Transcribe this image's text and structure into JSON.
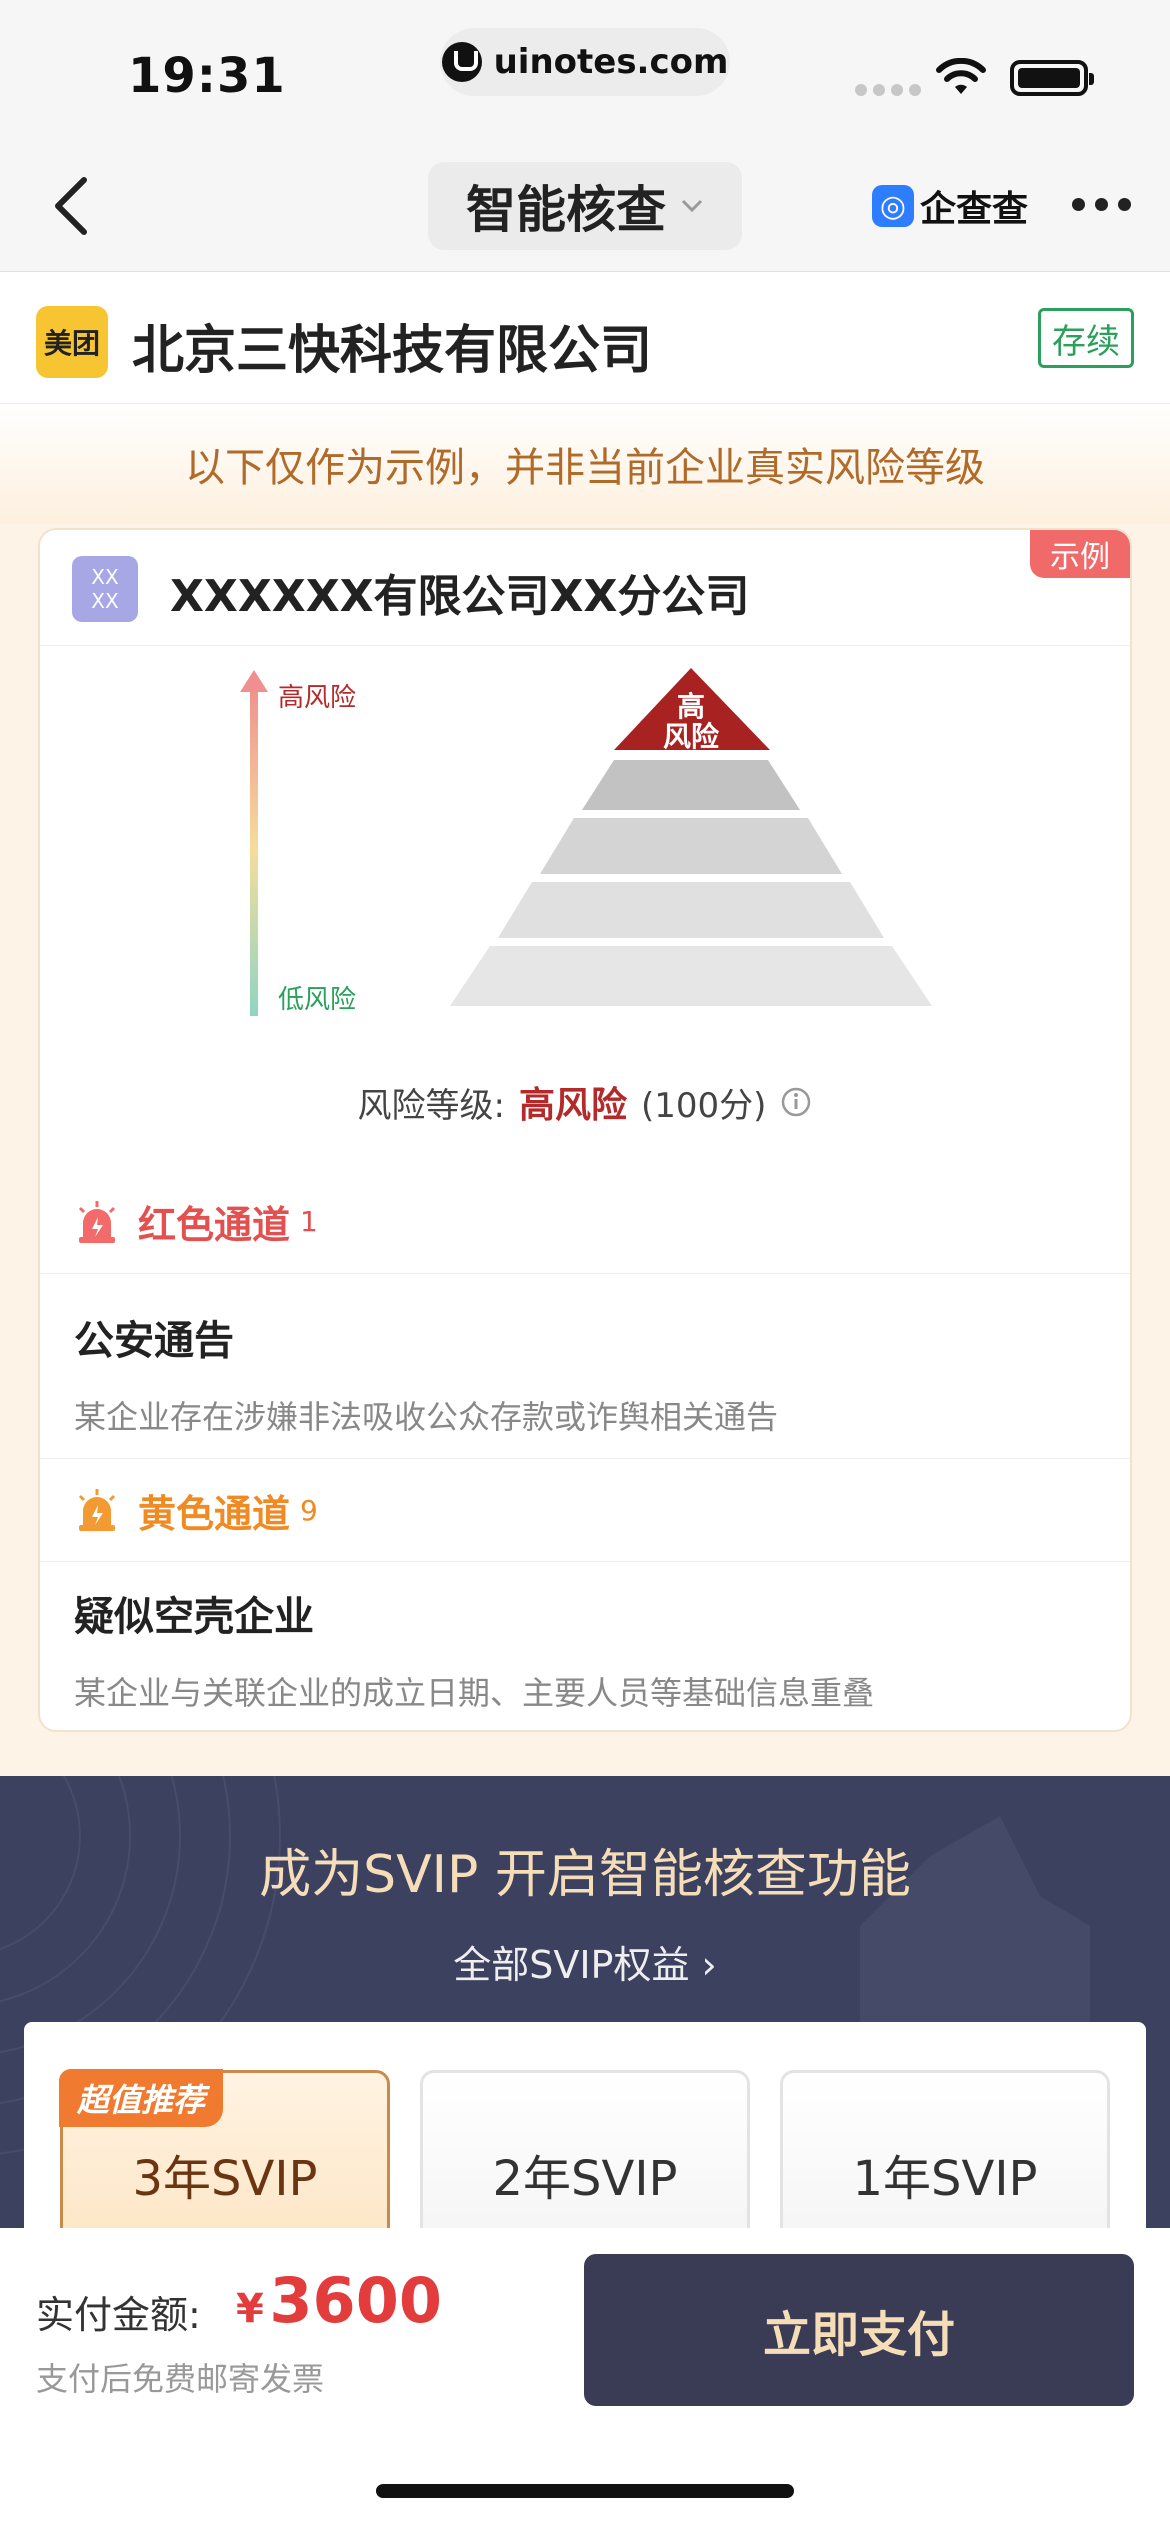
{
  "status_bar": {
    "time": "19:31",
    "url": "uinotes.com"
  },
  "nav": {
    "title": "智能核查",
    "brand": "企查查"
  },
  "company": {
    "logo_text": "美团",
    "name": "北京三快科技有限公司",
    "follow_label": "存续"
  },
  "notice": "以下仅作为示例，并非当前企业真实风险等级",
  "example_card": {
    "tag": "示例",
    "logo_line1": "XX",
    "logo_line2": "XX",
    "title": "XXXXXX有限公司XX分公司",
    "scale_high": "高风险",
    "scale_low": "低风险",
    "pyramid_top_line1": "高",
    "pyramid_top_line2": "风险",
    "risk_label": "风险等级:",
    "risk_value": "高风险",
    "risk_score": "(100分)"
  },
  "channels": {
    "red": {
      "label": "红色通道",
      "count": "1",
      "item_title": "公安通告",
      "item_desc": "某企业存在涉嫌非法吸收公众存款或诈舆相关通告"
    },
    "yellow": {
      "label": "黄色通道",
      "count": "9",
      "item_title": "疑似空壳企业",
      "item_desc": "某企业与关联企业的成立日期、主要人员等基础信息重叠"
    }
  },
  "promo": {
    "title": "成为SVIP 开启智能核查功能",
    "link": "全部SVIP权益 ›",
    "plans": [
      {
        "label": "3年SVIP",
        "badge": "超值推荐"
      },
      {
        "label": "2年SVIP"
      },
      {
        "label": "1年SVIP"
      }
    ]
  },
  "pay": {
    "label": "实付金额:",
    "currency": "¥",
    "amount": "3600",
    "note": "支付后免费邮寄发票",
    "button": "立即支付"
  },
  "colors": {
    "accent_red": "#e23c3c",
    "follow_green": "#2aa05a",
    "dark_bar": "#3a3b54",
    "gold_text": "#f5ddb8"
  }
}
